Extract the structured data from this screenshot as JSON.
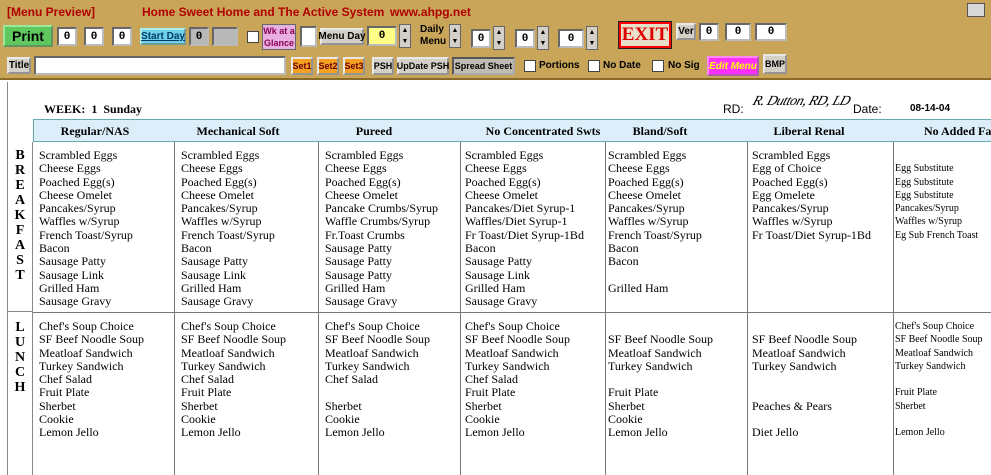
{
  "toolbar": {
    "preview_label": "[Menu Preview]",
    "app_title": "Home Sweet Home and The Active System",
    "app_url": "www.ahpg.net",
    "print_label": "Print",
    "print_boxes": [
      "0",
      "0",
      "0"
    ],
    "start_day_label": "Start Day",
    "start_day_value": "0",
    "wk_at_glance_label": "Wk at a Glance",
    "menu_day_label": "Menu Day",
    "menu_day_value": "0",
    "daily_menu_label": "Daily Menu",
    "daily_boxes": [
      "0",
      "0",
      "0"
    ],
    "exit_label": "EXIT",
    "ver_label": "Ver",
    "ver_boxes": [
      "0",
      "0",
      "0"
    ],
    "title_label": "Title",
    "title_value": "",
    "set1_label": "Set1",
    "set2_label": "Set2",
    "set3_label": "Set3",
    "psh_label": "PSH",
    "update_psh_label": "UpDate PSH",
    "spreadsheet_label": "Spread Sheet",
    "portions_label": "Portions",
    "no_date_label": "No Date",
    "no_sig_label": "No Sig",
    "edit_menu_label": "Edit Menu",
    "bmp_label": "BMP"
  },
  "menu": {
    "week_label": "WEEK:",
    "week_num": "1",
    "day": "Sunday",
    "rd_label": "RD:",
    "rd_signature": "R. Dutton, RD, LD",
    "date_label": "Date:",
    "date_value": "08-14-04",
    "meals": [
      "BREAKFAST",
      "LUNCH"
    ],
    "columns": [
      {
        "name": "Regular/NAS",
        "breakfast": [
          "Scrambled Eggs",
          "Cheese Eggs",
          "Poached Egg(s)",
          "Cheese Omelet",
          "Pancakes/Syrup",
          "Waffles w/Syrup",
          "French Toast/Syrup",
          "Bacon",
          "Sausage Patty",
          "Sausage Link",
          "Grilled Ham",
          "Sausage Gravy"
        ],
        "lunch": [
          "Chef's Soup Choice",
          "SF Beef Noodle Soup",
          "Meatloaf Sandwich",
          "Turkey Sandwich",
          "Chef Salad",
          "Fruit Plate",
          "Sherbet",
          "Cookie",
          "Lemon Jello"
        ]
      },
      {
        "name": "Mechanical Soft",
        "breakfast": [
          "Scrambled Eggs",
          "Cheese Eggs",
          "Poached Egg(s)",
          "Cheese Omelet",
          "Pancakes/Syrup",
          "Waffles w/Syrup",
          "French Toast/Syrup",
          "Bacon",
          "Sausage Patty",
          "Sausage Link",
          "Grilled Ham",
          "Sausage Gravy"
        ],
        "lunch": [
          "Chef's Soup Choice",
          "SF Beef Noodle Soup",
          "Meatloaf Sandwich",
          "Turkey Sandwich",
          "Chef Salad",
          "Fruit Plate",
          "Sherbet",
          "Cookie",
          "Lemon Jello"
        ]
      },
      {
        "name": "Pureed",
        "breakfast": [
          "Scrambled Eggs",
          "Cheese Eggs",
          "Poached Egg(s)",
          "Cheese Omelet",
          "Pancake Crumbs/Syrup",
          "Waffle Crumbs/Syrup",
          "Fr.Toast Crumbs",
          "Sausage Patty",
          "Sausage Patty",
          "Sausage Patty",
          "Grilled Ham",
          "Sausage Gravy"
        ],
        "lunch": [
          "Chef's Soup Choice",
          "SF Beef Noodle Soup",
          "Meatloaf Sandwich",
          "Turkey Sandwich",
          "Chef Salad",
          "",
          "Sherbet",
          "Cookie",
          "Lemon Jello"
        ]
      },
      {
        "name": "No Concentrated Swts",
        "breakfast": [
          "Scrambled Eggs",
          "Cheese Eggs",
          "Poached Egg(s)",
          "Cheese Omelet",
          "Pancakes/Diet Syrup-1",
          "Waffles/Diet Syrup-1",
          "Fr Toast/Diet Syrup-1Bd",
          "Bacon",
          "Sausage Patty",
          "Sausage Link",
          "Grilled Ham",
          "Sausage Gravy"
        ],
        "lunch": [
          "Chef's Soup Choice",
          "SF Beef Noodle Soup",
          "Meatloaf Sandwich",
          "Turkey Sandwich",
          "Chef Salad",
          "Fruit Plate",
          "Sherbet",
          "Cookie",
          "Lemon Jello"
        ]
      },
      {
        "name": "Bland/Soft",
        "breakfast": [
          "Scrambled Eggs",
          "Cheese Eggs",
          "Poached Egg(s)",
          "Cheese Omelet",
          "Pancakes/Syrup",
          "Waffles w/Syrup",
          "French Toast/Syrup",
          "Bacon",
          "Bacon",
          "",
          "Grilled Ham",
          ""
        ],
        "lunch": [
          "",
          "SF Beef Noodle Soup",
          "Meatloaf Sandwich",
          "Turkey Sandwich",
          "",
          "Fruit Plate",
          "Sherbet",
          "Cookie",
          "Lemon Jello"
        ]
      },
      {
        "name": "Liberal Renal",
        "breakfast": [
          "Scrambled Eggs",
          "Egg of Choice",
          "Poached Egg(s)",
          "Egg Omelete",
          "Pancakes/Syrup",
          "Waffles w/Syrup",
          "Fr Toast/Diet Syrup-1Bd"
        ],
        "lunch": [
          "",
          "SF Beef Noodle Soup",
          "Meatloaf Sandwich",
          "Turkey Sandwich",
          "",
          "",
          "Peaches & Pears",
          "",
          "Diet Jello"
        ]
      },
      {
        "name": "No Added Fat",
        "breakfast": [
          "",
          "Egg Substitute",
          "Egg Substitute",
          "Egg Substitute",
          "Pancakes/Syrup",
          "Waffles w/Syrup",
          "Eg Sub French Toast"
        ],
        "lunch": [
          "Chef's Soup Choice",
          "SF Beef Noodle Soup",
          "Meatloaf Sandwich",
          "Turkey Sandwich",
          "",
          "Fruit Plate",
          "Sherbet",
          "",
          "Lemon Jello"
        ]
      }
    ]
  }
}
